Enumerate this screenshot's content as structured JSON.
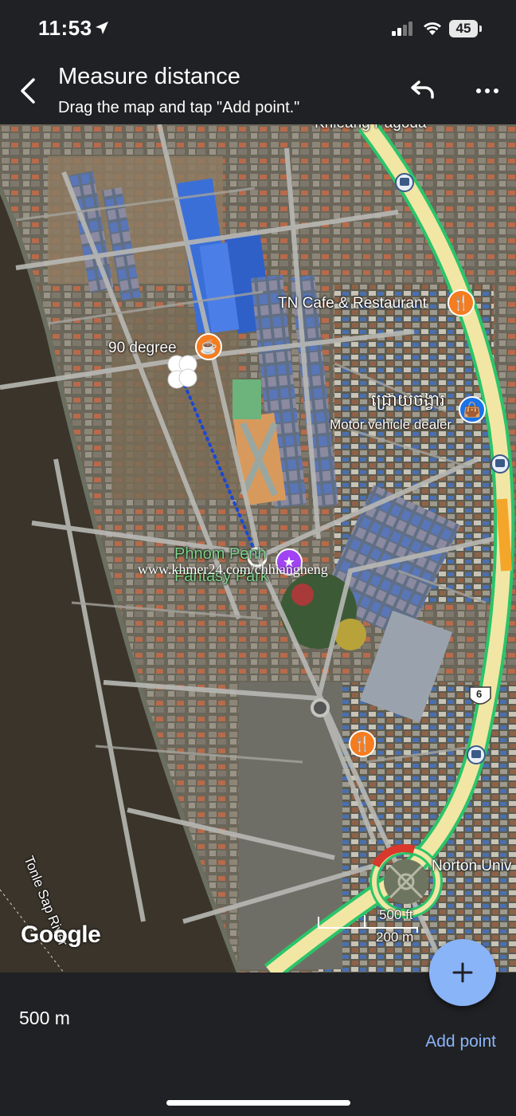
{
  "status": {
    "time": "11:53",
    "battery": "45"
  },
  "header": {
    "title": "Measure distance",
    "subtitle": "Drag the map and tap \"Add point.\""
  },
  "map": {
    "labels": {
      "pagoda": "Khleang Pagoda",
      "cafe": "TN Cafe & Restaurant",
      "degree": "90 degree",
      "khmer": "ជ្រោយចង្វារ",
      "motor": "Motor vehicle dealer",
      "park_line1": "Phnom Penh",
      "park_line2": "Fantasy Park",
      "norton": "Norton Univ",
      "river": "Tonle Sap River",
      "highway": "6"
    },
    "watermark": "www.khmer24.com/chhiangheng",
    "logo": "Google",
    "scale": {
      "feet": "500 ft",
      "meters": "200 m"
    }
  },
  "measure": {
    "distance": "500 m",
    "add_point_label": "Add point"
  },
  "colors": {
    "accent": "#8ab4f8",
    "route": "#1a47d6",
    "road_major": "#f4e7a6",
    "road_border": "#3ad17a",
    "poi_food": "#f57c1f",
    "poi_shop": "#1a73e8",
    "poi_attraction": "#a142f4"
  }
}
